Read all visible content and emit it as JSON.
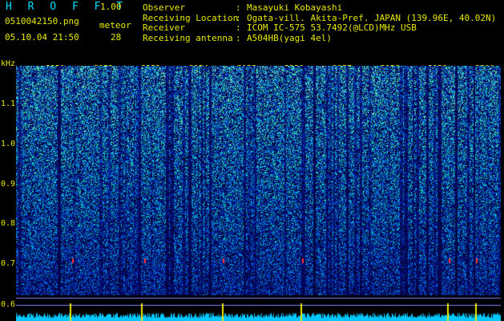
{
  "header": {
    "app_title": "H R O F F T",
    "version": "1.00",
    "filename": "0510042150.png",
    "datetime": "05.10.04 21:50",
    "meteor_label": "meteor",
    "meteor_count": "28"
  },
  "info": [
    {
      "label": "Observer",
      "sep": ":",
      "value": "Masayuki Kobayashi"
    },
    {
      "label": "Receiving Location",
      "sep": ":",
      "value": "Ogata-vill. Akita-Pref. JAPAN (139.96E, 40.02N)"
    },
    {
      "label": "Receiver",
      "sep": ":",
      "value": "ICOM IC-575 53.7492(@LCD)MHz USB"
    },
    {
      "label": "Receiving antenna",
      "sep": ":",
      "value": "A504HB(yagi 4el)"
    }
  ],
  "axes": {
    "y_unit": "kHz",
    "y_ticks": [
      "1.1",
      "1.0",
      "0.9",
      "0.8",
      "0.7",
      "0.6"
    ],
    "x_ticks": [
      "2151",
      "2152",
      "2153",
      "2154",
      "2155",
      "2156",
      "2157",
      "2158",
      "2159",
      "2200"
    ]
  },
  "colors": {
    "text": "#e8e800",
    "title": "#00e0ff",
    "background": "#000000",
    "signal_low": "#001a66",
    "signal_high": "#00e0b0",
    "noise_trace": "#00c8ff",
    "meteor_marker": "#ff3030"
  }
}
